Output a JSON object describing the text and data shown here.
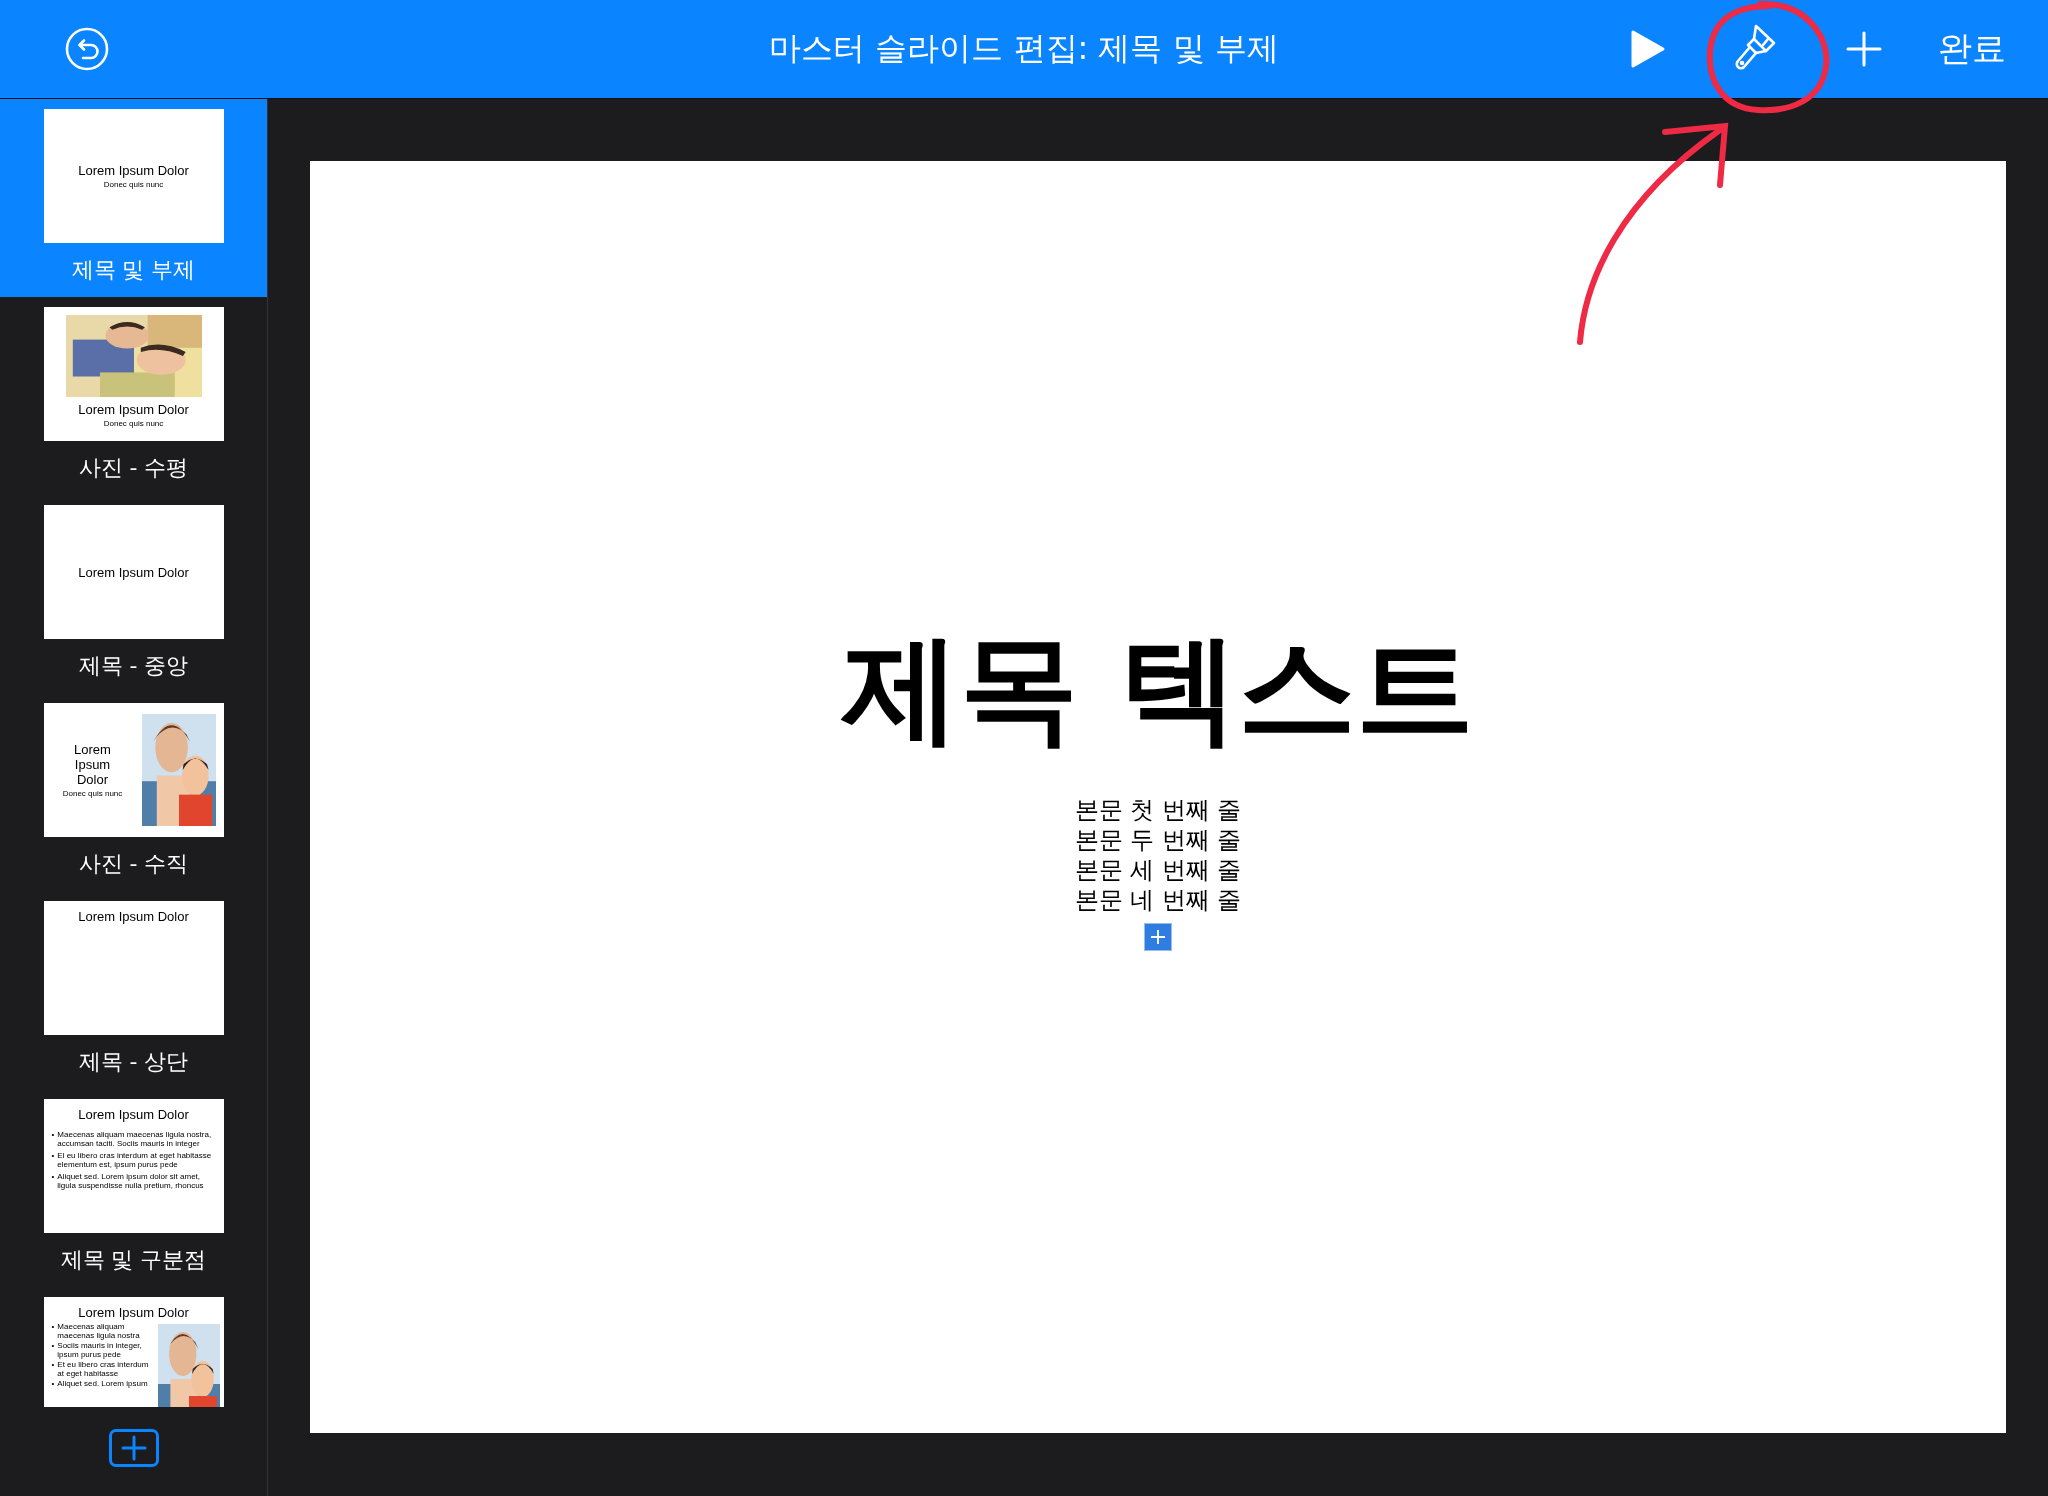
{
  "toolbar": {
    "title": "마스터 슬라이드 편집: 제목 및 부제",
    "done": "완료"
  },
  "masters": [
    {
      "kind": "title_subtitle",
      "title": "Lorem Ipsum Dolor",
      "subtitle": "Donec quis nunc",
      "name": "제목 및 부제",
      "selected": true
    },
    {
      "kind": "photo_horizontal",
      "title": "Lorem Ipsum Dolor",
      "subtitle": "Donec quis nunc",
      "name": "사진 - 수평",
      "selected": false
    },
    {
      "kind": "title_center",
      "title": "Lorem Ipsum Dolor",
      "name": "제목 - 중앙",
      "selected": false
    },
    {
      "kind": "photo_vertical",
      "title": "Lorem Ipsum Dolor",
      "subtitle": "Donec quis nunc",
      "name": "사진 - 수직",
      "selected": false
    },
    {
      "kind": "title_top",
      "title": "Lorem Ipsum Dolor",
      "name": "제목 - 상단",
      "selected": false
    },
    {
      "kind": "title_bullets",
      "title": "Lorem Ipsum Dolor",
      "marker": "•",
      "bullets": [
        "Maecenas aliquam maecenas ligula nostra, accumsan taciti. Sociis mauris in integer",
        "El eu libero cras interdum at eget habitasse elementum est, ipsum purus pede",
        "Aliquet sed. Lorem ipsum dolor sit amet, ligula suspendisse nulla pretium, rhoncus"
      ],
      "name": "제목 및 구분점",
      "selected": false
    },
    {
      "kind": "bullets_photo",
      "title": "Lorem Ipsum Dolor",
      "marker": "•",
      "bullets": [
        "Maecenas aliquam maecenas ligula nostra",
        "Sociis mauris in integer, ipsum purus pede",
        "Et eu libero cras interdum at eget habitasse",
        "Aliquet sed. Lorem ipsum"
      ],
      "selected": false
    }
  ],
  "slide": {
    "title": "제목 텍스트",
    "body": [
      "본문 첫 번째 줄",
      "본문 두 번째 줄",
      "본문 세 번째 줄",
      "본문 네 번째 줄"
    ]
  }
}
